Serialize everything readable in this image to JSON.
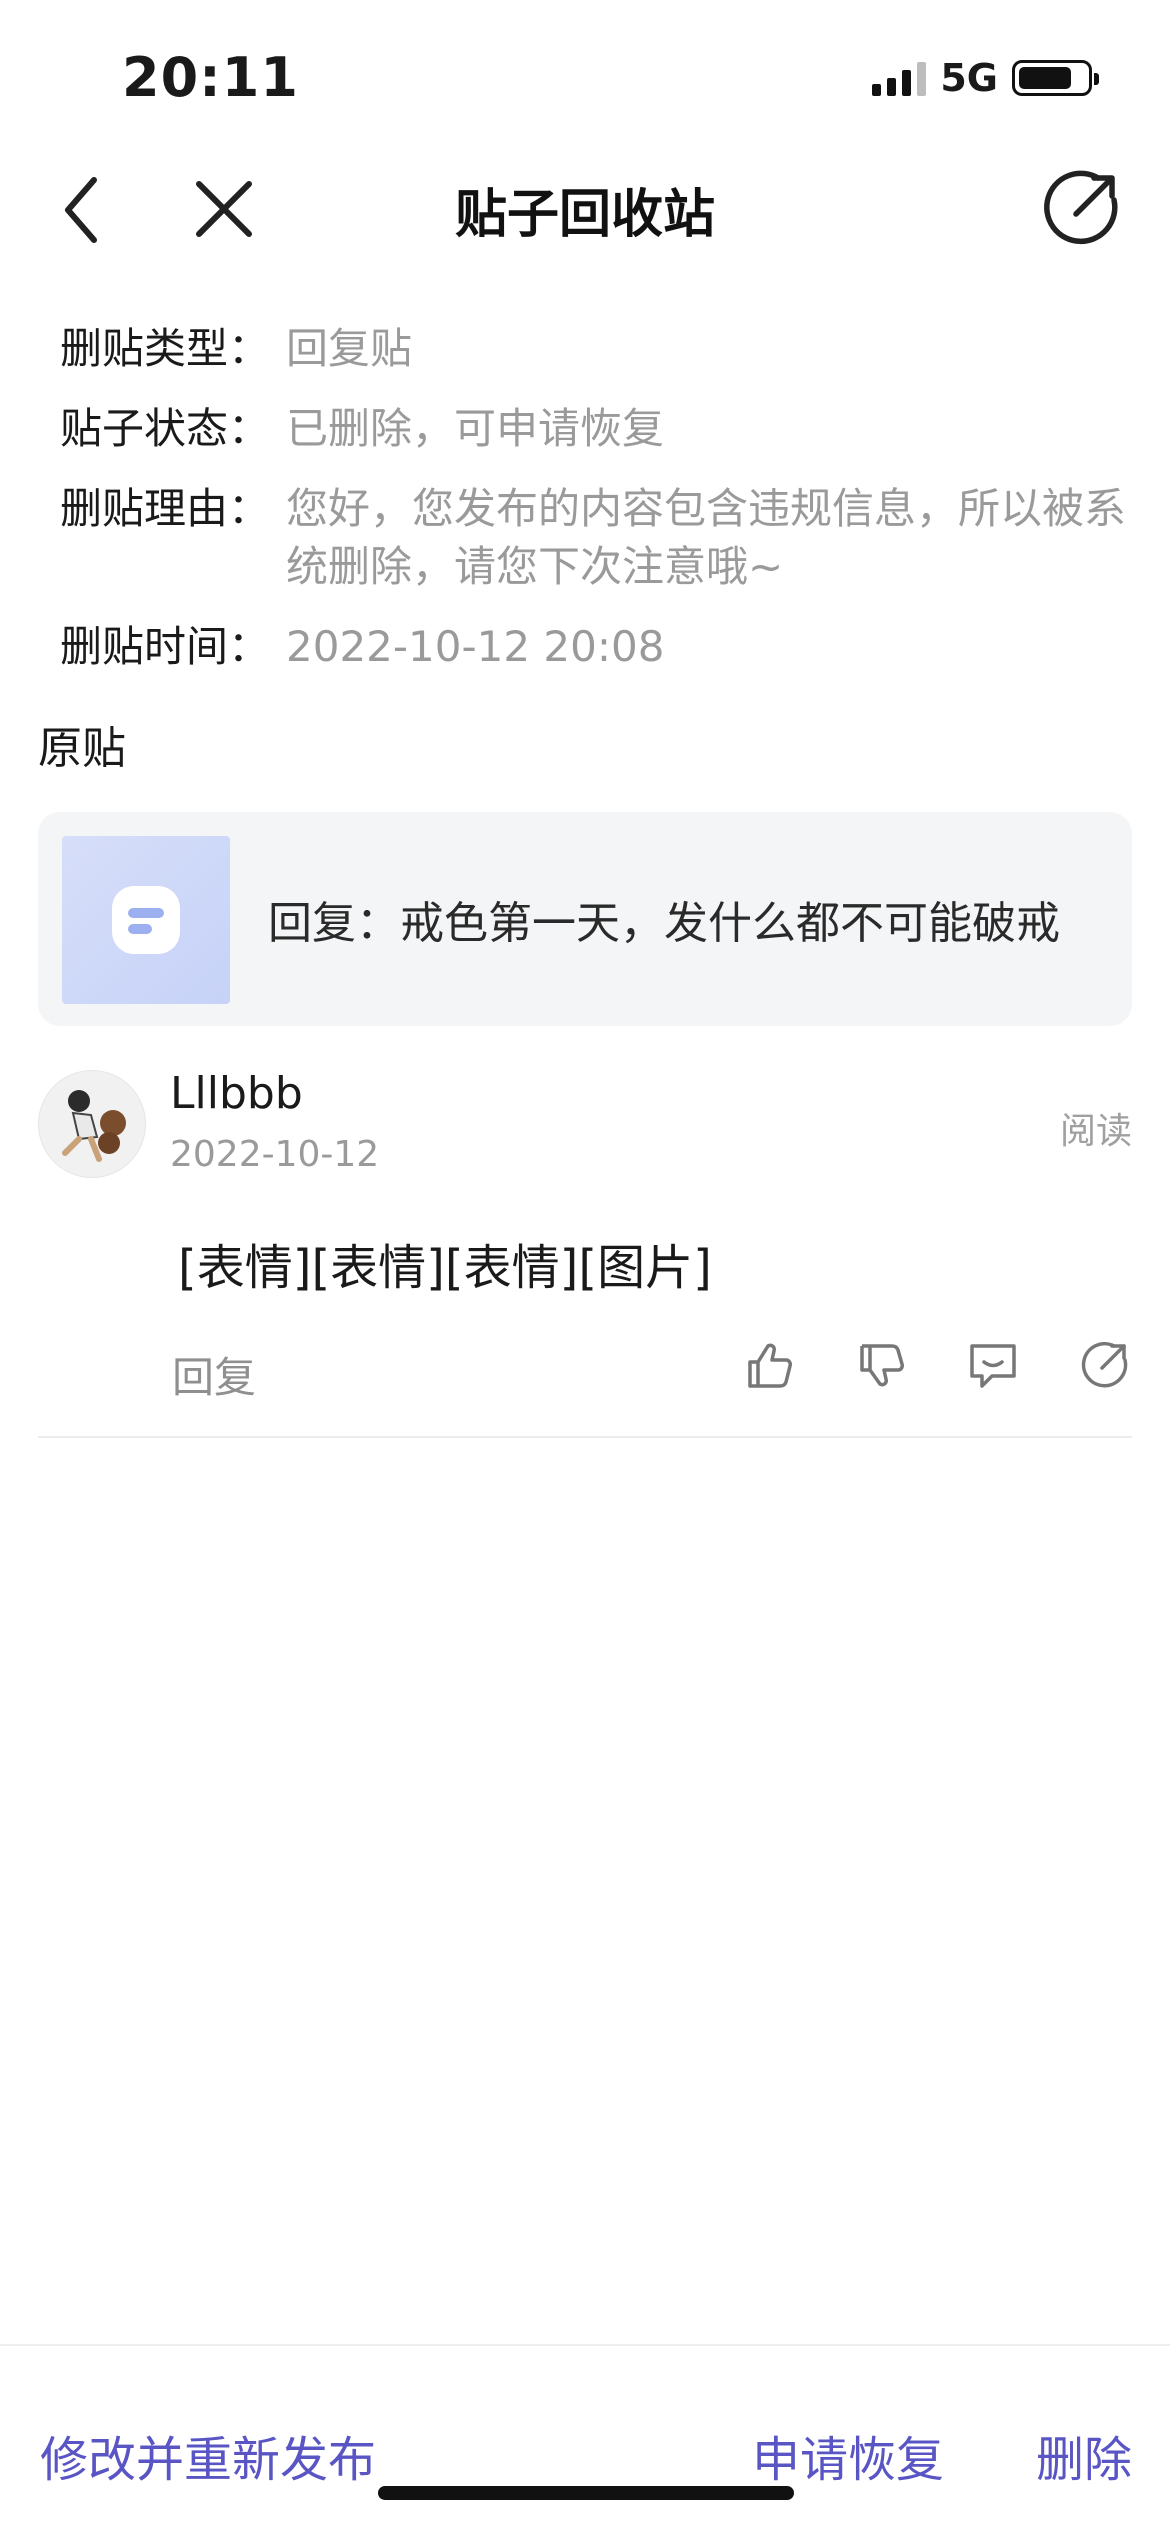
{
  "status_bar": {
    "time": "20:11",
    "network": "5G"
  },
  "nav": {
    "title": "贴子回收站",
    "back_icon": "chevron-left-icon",
    "close_icon": "close-icon",
    "share_icon": "share-icon"
  },
  "info": {
    "rows": [
      {
        "label": "删贴类型：",
        "value": "回复贴"
      },
      {
        "label": "贴子状态：",
        "value": "已删除，可申请恢复"
      },
      {
        "label": "删贴理由：",
        "value": "您好，您发布的内容包含违规信息，所以被系统删除，请您下次注意哦~"
      },
      {
        "label": "删贴时间：",
        "value": "2022-10-12 20:08"
      }
    ]
  },
  "original": {
    "section_title": "原贴",
    "text": "回复：戒色第一天，发什么都不可能破戒"
  },
  "post": {
    "username": "Lllbbb",
    "date": "2022-10-12",
    "read_label": "阅读",
    "content": "[表情][表情][表情][图片]",
    "reply_label": "回复",
    "action_icons": [
      "thumbs-up-icon",
      "thumbs-down-icon",
      "comment-icon",
      "share-icon"
    ]
  },
  "bottom_bar": {
    "edit_label": "修改并重新发布",
    "restore_label": "申请恢复",
    "delete_label": "删除",
    "accent_color": "#5a55c4"
  }
}
